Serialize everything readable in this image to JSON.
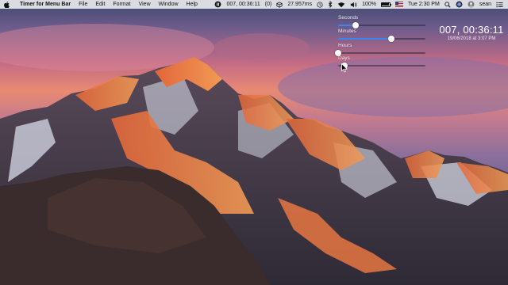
{
  "menubar": {
    "app_name": "Timer for Menu Bar",
    "menus": [
      "File",
      "Edit",
      "Format",
      "View",
      "Window",
      "Help"
    ],
    "status": {
      "timer": "007, 00:36:11",
      "badge": "(0)",
      "rate": "27.957ms",
      "battery_text": "100%",
      "battery_level": 1.0,
      "clock": "Tue 2:30 PM",
      "user": "sean"
    }
  },
  "timer_panel": {
    "sliders": [
      {
        "label": "Seconds",
        "level": 0.2,
        "fill": true
      },
      {
        "label": "Minutes",
        "level": 0.61,
        "fill": true
      },
      {
        "label": "Hours",
        "level": 0.0,
        "fill": false
      },
      {
        "label": "Days",
        "level": 0.07,
        "fill": false
      }
    ],
    "readout": "007, 00:36:11",
    "start_date": "19/06/2018 at 3:07 PM"
  },
  "colors": {
    "accent": "#3b86f0",
    "menubar_bg": "#e8e8ec"
  }
}
